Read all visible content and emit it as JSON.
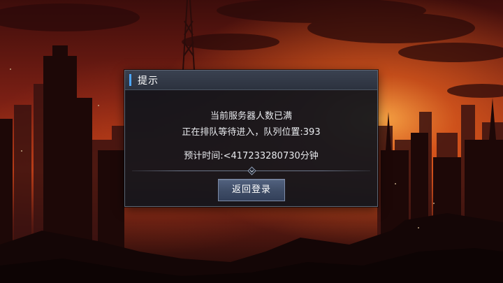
{
  "dialog": {
    "title": "提示",
    "message_line1": "当前服务器人数已满",
    "message_line2": "正在排队等待进入，队列位置:393",
    "message_line3": "预计时间:<417233280730分钟",
    "button_label": "返回登录"
  },
  "colors": {
    "sky_top": "#5a1410",
    "sky_glow": "#e05a1c",
    "dialog_bg": "#10141c",
    "header_bg": "#333a47",
    "accent": "#4da6ff",
    "button_bg": "#46556f"
  },
  "icons": {
    "divider_ornament": "chevron-diamond-icon"
  }
}
